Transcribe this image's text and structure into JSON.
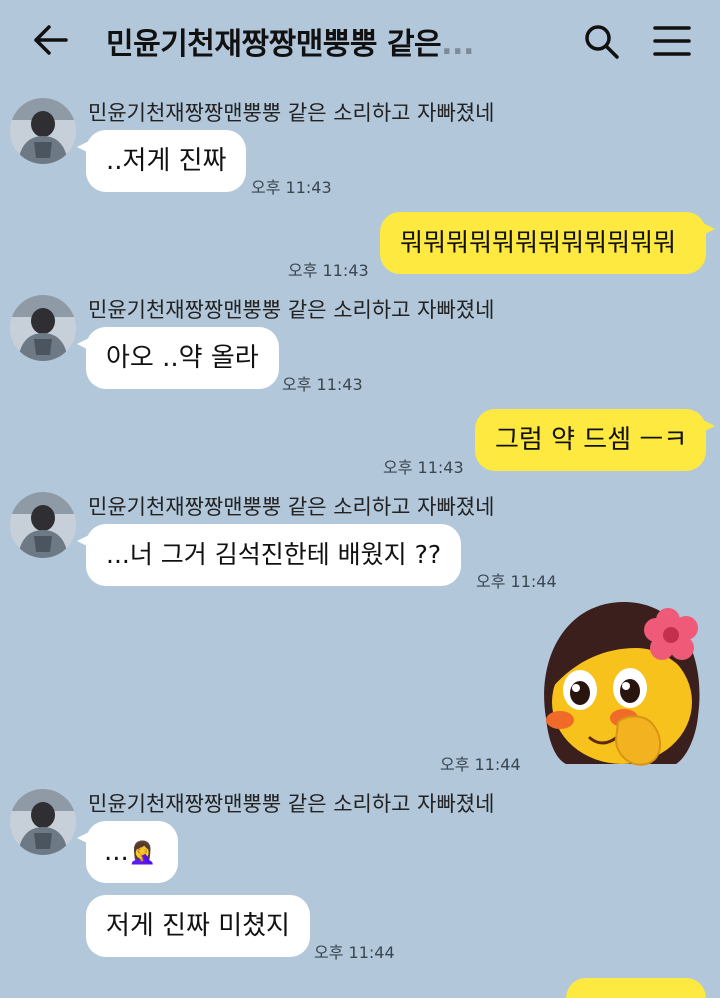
{
  "header": {
    "title": "민윤기천재짱짱맨뿡뿡 같은",
    "title_ellipsis": "...",
    "back_icon": "arrow-left-icon",
    "search_icon": "search-icon",
    "menu_icon": "hamburger-menu-icon"
  },
  "colors": {
    "background": "#b2c7da",
    "incoming_bubble": "#ffffff",
    "outgoing_bubble": "#fde93f"
  },
  "sender_name": "민윤기천재짱짱맨뿡뿡 같은 소리하고 자빠졌네",
  "messages": [
    {
      "direction": "in",
      "text": "..저게 진짜",
      "time": "오후 11:43"
    },
    {
      "direction": "out",
      "text": "뭐뭐뭐뭐뭐뭐뭐뭐뭐뭐뭐뭐",
      "time": "오후 11:43"
    },
    {
      "direction": "in",
      "text": "아오 ..약 올라",
      "time": "오후 11:43"
    },
    {
      "direction": "out",
      "text": "그럼 약 드셈 ㅡㅋ",
      "time": "오후 11:43"
    },
    {
      "direction": "in",
      "text": "...너 그거 김석진한테 배웠지 ??",
      "time": "오후 11:44"
    },
    {
      "direction": "out",
      "sticker": "blushing-girl-emoji-sticker",
      "time": "오후 11:44"
    },
    {
      "direction": "in",
      "text": "...",
      "emoji": "🤦‍♀️",
      "time": ""
    },
    {
      "direction": "in",
      "text": "저게 진짜 미쳤지",
      "time": "오후 11:44"
    }
  ]
}
